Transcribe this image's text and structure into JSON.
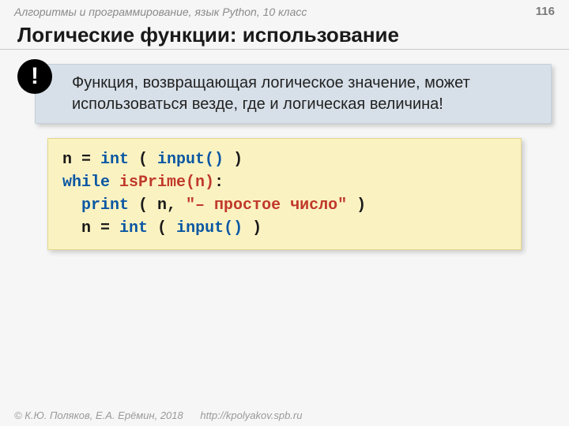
{
  "header": {
    "course": "Алгоритмы и программирование, язык Python, 10 класс",
    "page": "116"
  },
  "title": "Логические функции: использование",
  "callout": {
    "bang": "!",
    "text": "Функция, возвращающая логическое значение, может использоваться везде, где и логическая величина!"
  },
  "code": {
    "l1_a": "n = ",
    "l1_int": "int",
    "l1_b": " ( ",
    "l1_input": "input()",
    "l1_c": " )",
    "l2_while": "while",
    "l2_b": " ",
    "l2_fn": "isPrime(n)",
    "l2_c": ":",
    "l3_indent": "  ",
    "l3_print": "print",
    "l3_b": " ( n, ",
    "l3_str": "\"– простое число\"",
    "l3_c": " )",
    "l4_indent": "  ",
    "l4_a": "n = ",
    "l4_int": "int",
    "l4_b": " ( ",
    "l4_input": "input()",
    "l4_c": " )"
  },
  "footer": {
    "copyright": "© К.Ю. Поляков, Е.А. Ерёмин, 2018",
    "url": "http://kpolyakov.spb.ru"
  }
}
